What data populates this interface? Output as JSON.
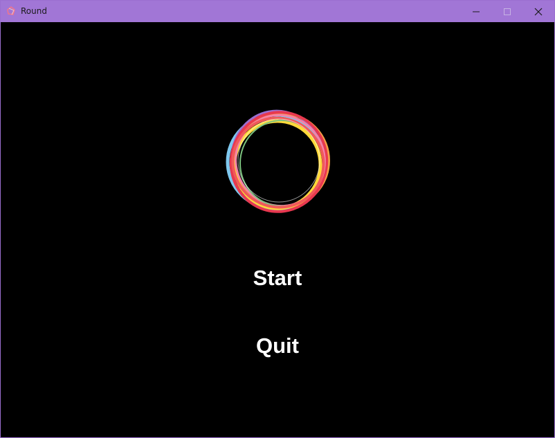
{
  "window": {
    "title": "Round",
    "titlebar_color": "#a176d6",
    "background_color": "#000000"
  },
  "controls": {
    "minimize_icon": "minimize-icon",
    "maximize_icon": "maximize-icon",
    "close_icon": "close-icon"
  },
  "logo": {
    "icon": "round-logo-icon",
    "ring_colors": [
      "#f05a5a",
      "#7fc8ef",
      "#ffd93a",
      "#f59f45",
      "#9b6fd0",
      "#e8384f",
      "#7cc47f",
      "#f582a8"
    ]
  },
  "menu": {
    "start_label": "Start",
    "quit_label": "Quit",
    "text_color": "#ffffff"
  }
}
